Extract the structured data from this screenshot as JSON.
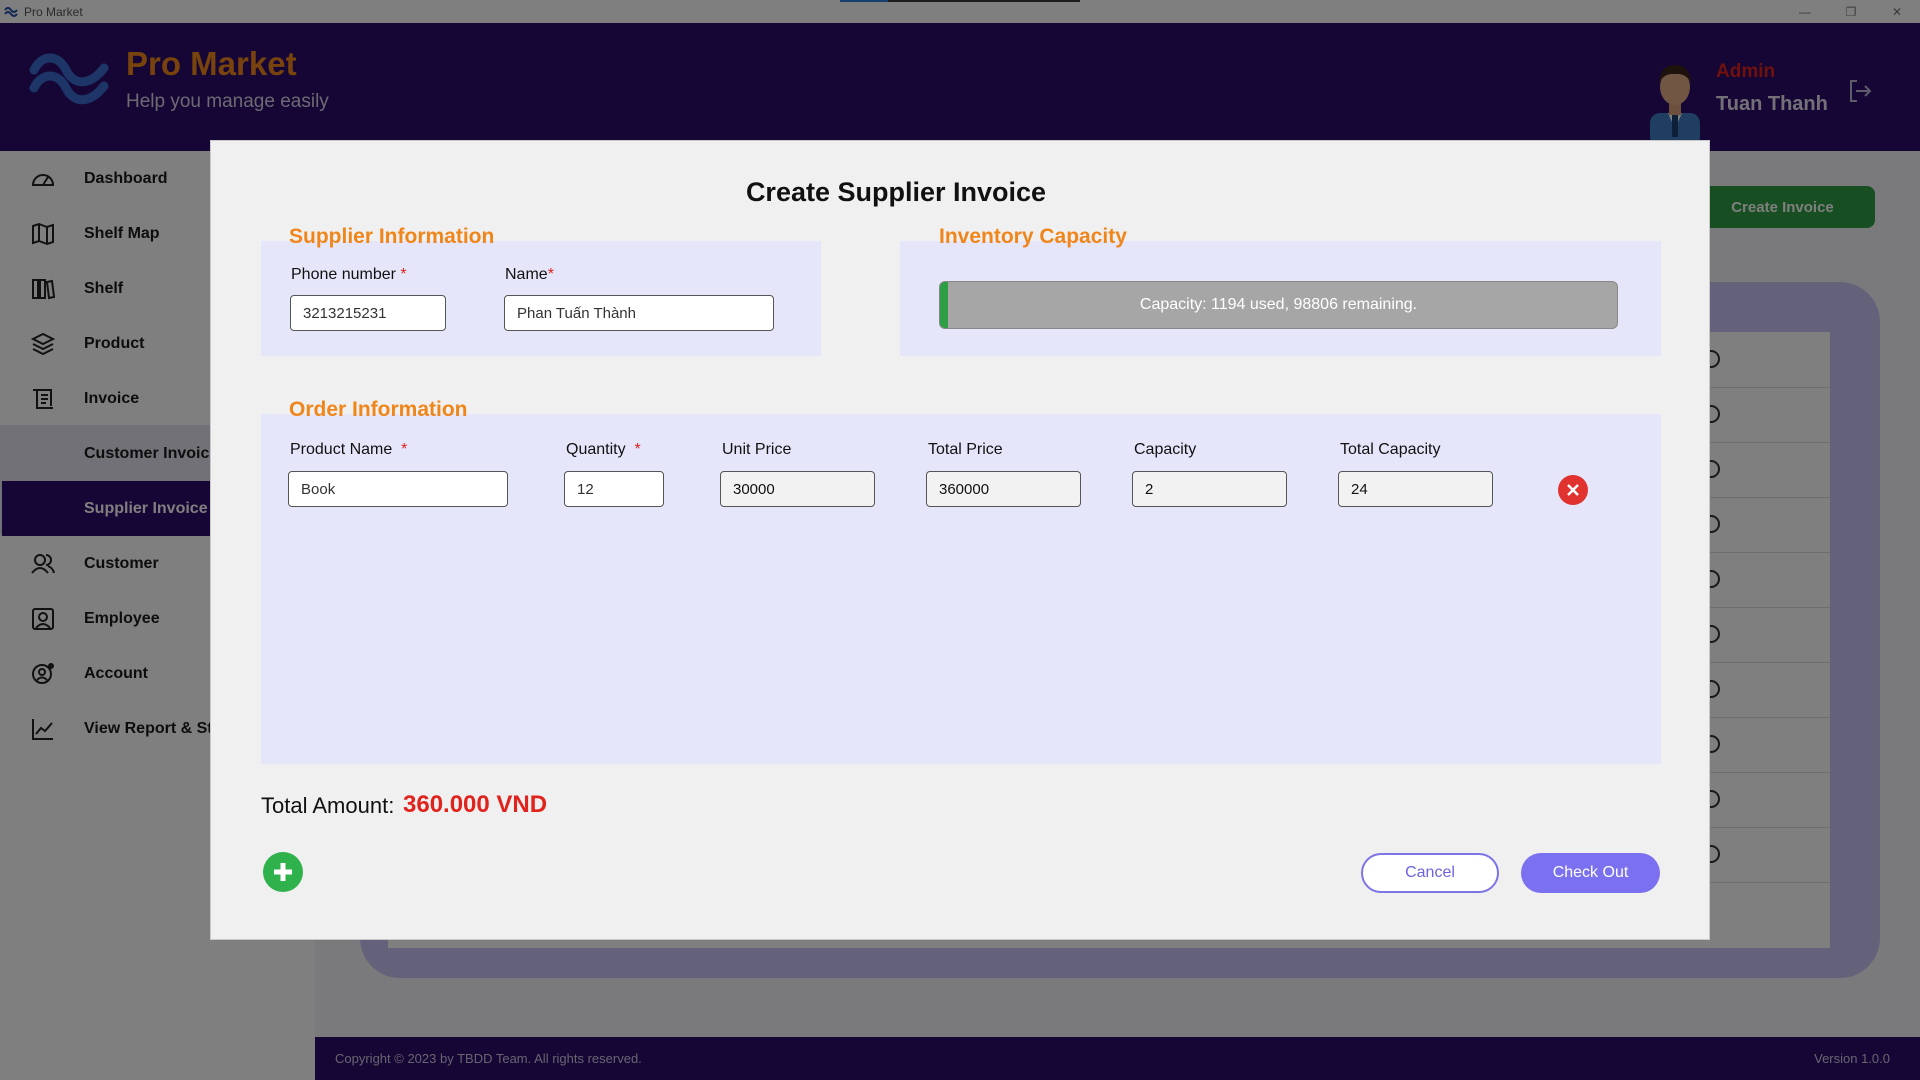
{
  "window": {
    "title": "Pro Market",
    "minimize": "—",
    "restore": "❐",
    "close": "✕"
  },
  "header": {
    "brand_title": "Pro Market",
    "brand_subtitle": "Help you manage easily",
    "role": "Admin",
    "username": "Tuan Thanh",
    "logout_icon": "logout-icon"
  },
  "sidebar": {
    "items": [
      {
        "label": "Dashboard",
        "icon": "dashboard-icon"
      },
      {
        "label": "Shelf Map",
        "icon": "map-icon"
      },
      {
        "label": "Shelf",
        "icon": "shelf-icon"
      },
      {
        "label": "Product",
        "icon": "layers-icon"
      },
      {
        "label": "Invoice",
        "icon": "invoice-icon"
      },
      {
        "label": "Customer Invoice",
        "icon": ""
      },
      {
        "label": "Supplier Invoice",
        "icon": ""
      },
      {
        "label": "Customer",
        "icon": "customer-icon"
      },
      {
        "label": "Employee",
        "icon": "employee-icon"
      },
      {
        "label": "Account",
        "icon": "account-icon"
      },
      {
        "label": "View Report & Statistics",
        "icon": "chart-icon"
      }
    ],
    "active": "Supplier Invoice"
  },
  "main": {
    "create_invoice_label": "Create Invoice"
  },
  "footer": {
    "copyright": "Copyright © 2023 by TBDD Team. All rights reserved.",
    "version": "Version 1.0.0"
  },
  "dialog": {
    "title": "Create Supplier Invoice",
    "supplier": {
      "section_title": "Supplier Information",
      "phone_label": "Phone number",
      "phone_value": "3213215231",
      "name_label": "Name",
      "name_value": "Phan Tuấn Thành",
      "required_mark": "*"
    },
    "inventory": {
      "section_title": "Inventory Capacity",
      "capacity_text": "Capacity: 1194 used, 98806 remaining.",
      "used": 1194,
      "remaining": 98806,
      "fill_fraction": 0.012
    },
    "order": {
      "section_title": "Order Information",
      "columns": {
        "product_name": "Product Name",
        "quantity": "Quantity",
        "unit_price": "Unit Price",
        "total_price": "Total Price",
        "capacity": "Capacity",
        "total_capacity": "Total Capacity"
      },
      "rows": [
        {
          "product_name": "Book",
          "quantity": "12",
          "unit_price": "30000",
          "total_price": "360000",
          "capacity": "2",
          "total_capacity": "24"
        }
      ]
    },
    "total_label": "Total Amount:",
    "total_value": "360.000 VND",
    "cancel_label": "Cancel",
    "checkout_label": "Check Out"
  },
  "colors": {
    "header_bg": "#2a0c6b",
    "accent_orange": "#f0861b",
    "alert_red": "#e0231c",
    "primary_purple": "#7b71f0",
    "success_green": "#2e9e45"
  }
}
